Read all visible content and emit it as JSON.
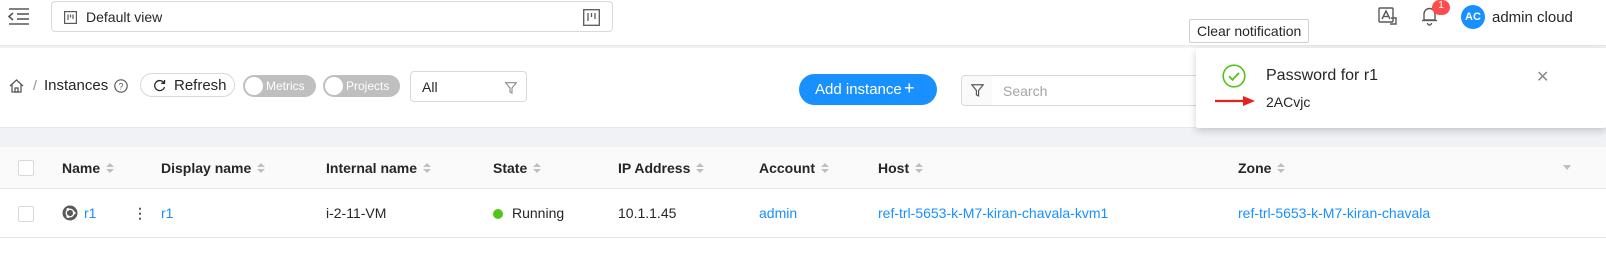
{
  "topbar": {
    "view_label": "Default view",
    "tooltip": "Clear notification",
    "notification_count": "1",
    "avatar_initials": "AC",
    "username": "admin cloud"
  },
  "toolbar": {
    "breadcrumb_separator": "/",
    "breadcrumb_page": "Instances",
    "refresh_label": "Refresh",
    "metrics_label": "Metrics",
    "projects_label": "Projects",
    "filter_value": "All",
    "add_label": "Add instance",
    "search_placeholder": "Search"
  },
  "notification": {
    "title": "Password for r1",
    "message": "2ACvjc"
  },
  "table": {
    "columns": [
      "Name",
      "Display name",
      "Internal name",
      "State",
      "IP Address",
      "Account",
      "Host",
      "Zone"
    ],
    "rows": [
      {
        "name": "r1",
        "display_name": "r1",
        "internal_name": "i-2-11-VM",
        "state": "Running",
        "ip": "10.1.1.45",
        "account": "admin",
        "host": "ref-trl-5653-k-M7-kiran-chavala-kvm1",
        "zone": "ref-trl-5653-k-M7-kiran-chavala"
      }
    ]
  },
  "colors": {
    "primary": "#1890ff",
    "success": "#52c41a",
    "badge": "#ff4d4f",
    "arrow": "#e8201c"
  },
  "icons": [
    "menu-fold-icon",
    "project-board-icon",
    "translate-icon",
    "bell-icon",
    "home-icon",
    "question-circle-icon",
    "reload-icon",
    "filter-icon",
    "plus-icon",
    "check-circle-icon",
    "close-icon",
    "ubuntu-icon",
    "more-vertical-icon"
  ]
}
